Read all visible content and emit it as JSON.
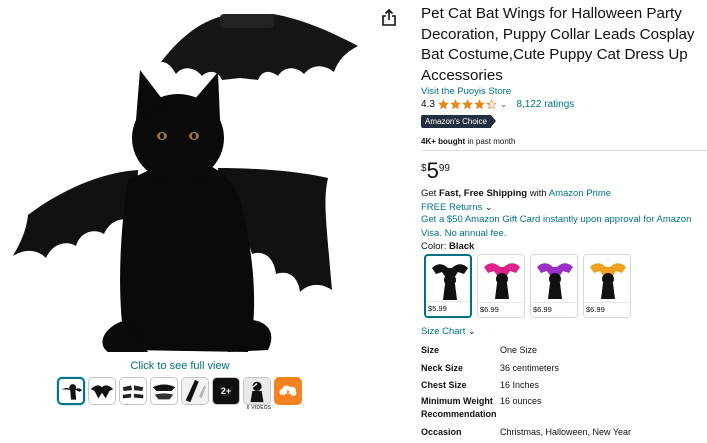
{
  "product": {
    "title": "Pet Cat Bat Wings for Halloween Party Decoration, Puppy Collar Leads Cosplay Bat Costume,Cute Puppy Cat Dress Up Accessories",
    "store_link": "Visit the Puoyis Store",
    "rating": "4.3",
    "rating_stars": 4.3,
    "review_count": "8,122 ratings",
    "badge": "Amazon's Choice",
    "bought_bold": "4K+ bought",
    "bought_rest": " in past month",
    "price": {
      "symbol": "$",
      "whole": "5",
      "fraction": "99"
    },
    "shipping": {
      "prefix": "Get ",
      "bold": "Fast, Free Shipping",
      "middle": " with ",
      "link": "Amazon Prime"
    },
    "returns": "FREE Returns",
    "gift_card": "Get a $50 Amazon Gift Card instantly upon approval for Amazon Visa. No annual fee.",
    "color_label": "Color: ",
    "color_value": "Black",
    "swatches": [
      {
        "price": "$5.99",
        "color": "#111111",
        "selected": true
      },
      {
        "price": "$6.99",
        "color": "#e0218a",
        "selected": false
      },
      {
        "price": "$6.99",
        "color": "#9b30c8",
        "selected": false
      },
      {
        "price": "$6.99",
        "color": "#f0a020",
        "selected": false
      }
    ],
    "size_chart": "Size Chart",
    "specs": [
      {
        "key": "Size",
        "value": "One Size"
      },
      {
        "key": "Neck Size",
        "value": "36 centimeters"
      },
      {
        "key": "Chest Size",
        "value": "16 Inches"
      },
      {
        "key": "Minimum Weight Recommendation",
        "value": "16 ounces"
      },
      {
        "key": "Occasion",
        "value": "Christmas, Halloween, New Year"
      }
    ]
  },
  "gallery": {
    "full_view_link": "Click to see full view",
    "more_count": "2+",
    "videos_caption": "6 VIDEOS",
    "accent_color": "#007185"
  },
  "colors": {
    "link": "#007185",
    "badge_bg": "#232f3e",
    "star": "#f08804"
  }
}
